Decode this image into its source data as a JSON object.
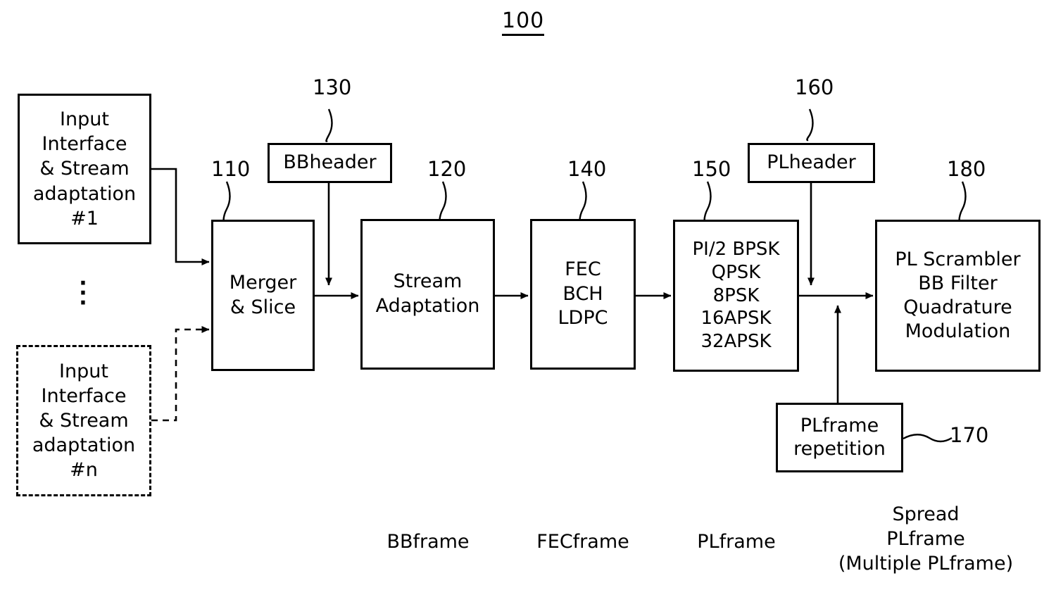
{
  "figure": {
    "number": "100"
  },
  "blocks": {
    "input1": {
      "label": "Input\nInterface\n& Stream\nadaptation\n#1",
      "ref": ""
    },
    "inputn": {
      "label": "Input\nInterface\n& Stream\nadaptation\n#n",
      "ref": ""
    },
    "merger": {
      "label": "Merger\n& Slice",
      "ref": "110"
    },
    "bbheader": {
      "label": "BBheader",
      "ref": "130"
    },
    "stream_adaptation": {
      "label": "Stream\nAdaptation",
      "ref": "120"
    },
    "fec": {
      "label": "FEC\nBCH\nLDPC",
      "ref": "140"
    },
    "modulation": {
      "label": "PI/2 BPSK\nQPSK\n8PSK\n16APSK\n32APSK",
      "ref": "150"
    },
    "plheader": {
      "label": "PLheader",
      "ref": "160"
    },
    "plframe_repetition": {
      "label": "PLframe\nrepetition",
      "ref": "170"
    },
    "pl_scrambler": {
      "label": "PL Scrambler\nBB Filter\nQuadrature\nModulation",
      "ref": "180"
    }
  },
  "ellipsis": "·\n·\n·",
  "captions": {
    "bbframe": "BBframe",
    "fecframe": "FECframe",
    "plframe": "PLframe",
    "spread_plframe": "Spread\nPLframe\n(Multiple PLframe)"
  },
  "colors": {
    "stroke": "#000000",
    "background": "#ffffff"
  }
}
